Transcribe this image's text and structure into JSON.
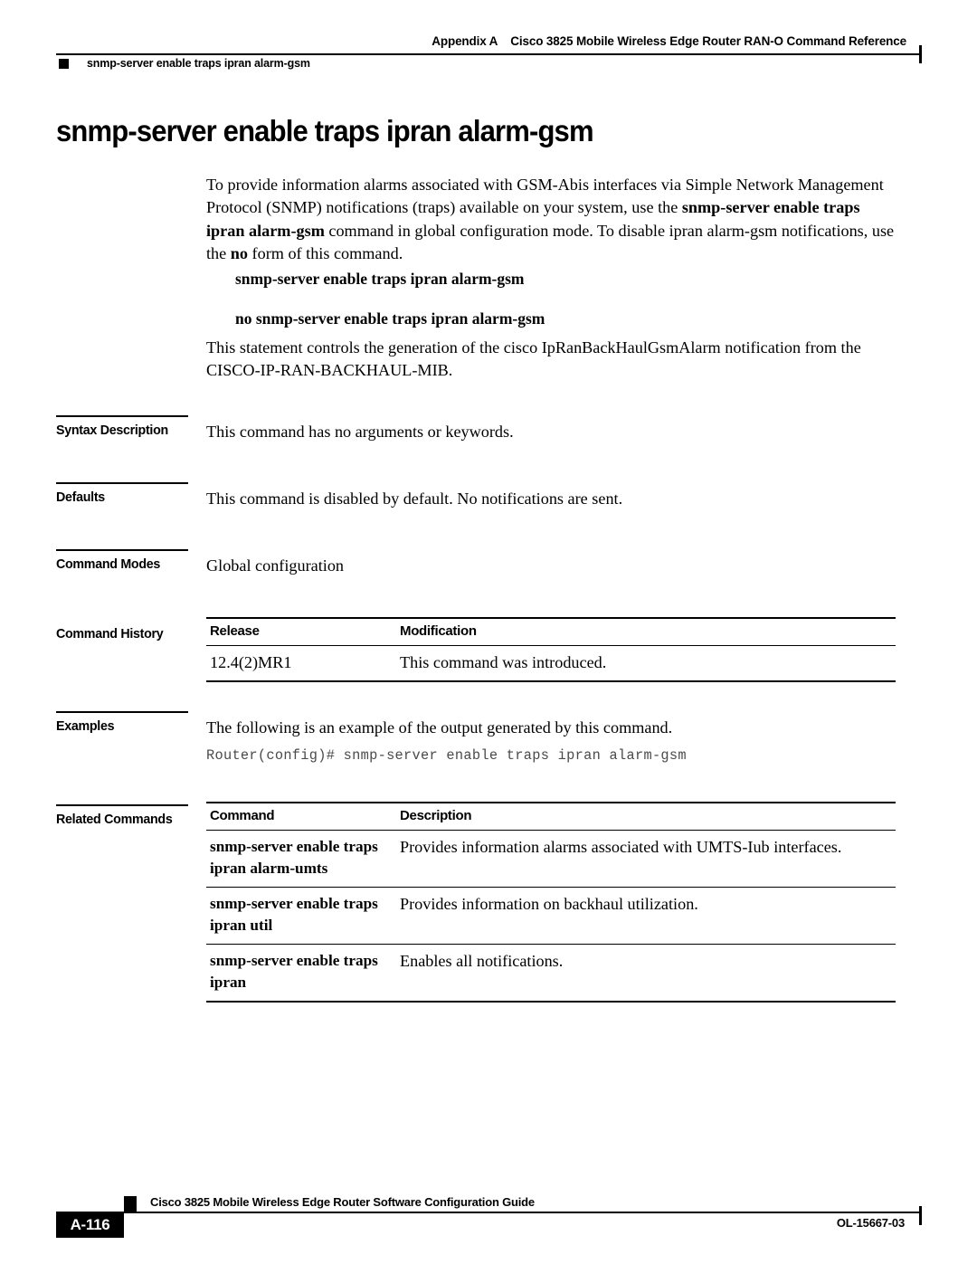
{
  "header": {
    "appendix": "Appendix A",
    "title": "Cisco 3825 Mobile Wireless Edge Router RAN-O Command Reference",
    "running_command": "snmp-server enable traps ipran alarm-gsm"
  },
  "command": {
    "title": "snmp-server enable traps ipran alarm-gsm",
    "intro_part1": "To provide information alarms associated with GSM-Abis interfaces via Simple Network Management Protocol (SNMP) notifications (traps) available on your system, use the ",
    "intro_bold1": "snmp-server enable traps ipran alarm-gsm",
    "intro_part2": " command in global configuration mode. To disable ipran alarm-gsm notifications, use the ",
    "intro_bold2": "no",
    "intro_part3": " form of this command.",
    "syntax_affirmative": "snmp-server enable traps ipran alarm-gsm",
    "syntax_negative": "no snmp-server enable traps ipran alarm-gsm",
    "statement": "This statement controls the generation of the cisco IpRanBackHaulGsmAlarm notification from the CISCO-IP-RAN-BACKHAUL-MIB."
  },
  "sections": {
    "syntax_description": {
      "label": "Syntax Description",
      "text": "This command has no arguments or keywords."
    },
    "defaults": {
      "label": "Defaults",
      "text": "This command is disabled by default. No notifications are sent."
    },
    "command_modes": {
      "label": "Command Modes",
      "text": "Global configuration"
    },
    "command_history": {
      "label": "Command History",
      "headers": [
        "Release",
        "Modification"
      ],
      "rows": [
        [
          "12.4(2)MR1",
          "This command was introduced."
        ]
      ]
    },
    "examples": {
      "label": "Examples",
      "text": "The following is an example of the output generated by this command.",
      "code": "Router(config)# snmp-server enable traps ipran alarm-gsm"
    },
    "related_commands": {
      "label": "Related Commands",
      "headers": [
        "Command",
        "Description"
      ],
      "rows": [
        [
          "snmp-server enable traps ipran alarm-umts",
          "Provides information alarms associated with UMTS-Iub interfaces."
        ],
        [
          "snmp-server enable traps ipran util",
          "Provides information on backhaul utilization."
        ],
        [
          "snmp-server enable traps ipran",
          "Enables all notifications."
        ]
      ]
    }
  },
  "footer": {
    "guide_title": "Cisco 3825 Mobile Wireless Edge Router Software Configuration Guide",
    "page_number": "A-116",
    "doc_number": "OL-15667-03"
  }
}
